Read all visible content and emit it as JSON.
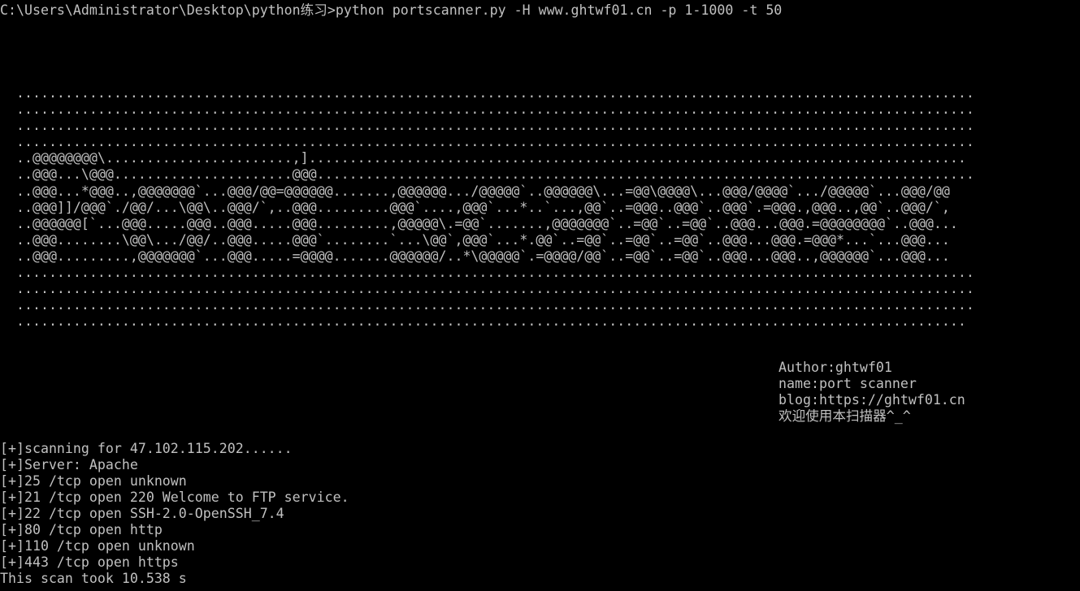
{
  "console": {
    "prompt": "C:\\Users\\Administrator\\Desktop\\python练习>",
    "command": "python portscanner.py -H www.ghtwf01.cn -p 1-1000 -t 50"
  },
  "banner": {
    "lines": [
      "  ......................................................................................................................",
      "  ......................................................................................................................",
      "  ......................................................................................................................",
      "  ......................................................................................................................",
      "  ..@@@@@@@@\\.......................,].................................................................................",
      "  ..@@@...\\@@@......................@@@.................................................................................",
      "  ..@@@...*@@@..,@@@@@@@`...@@@/@@=@@@@@@.......,@@@@@@.../@@@@@`..@@@@@@\\...=@@\\@@@@\\...@@@/@@@@`.../@@@@@`...@@@/@@",
      "  ..@@@]]/@@@`./@@/...\\@@\\..@@@/`,..@@@.........@@@`....,@@@`...*..`...,@@`..=@@@..@@@`..@@@`.=@@@.,@@@..,@@`..@@@/`,",
      "  ..@@@@@@[`...@@@.....@@@..@@@.....@@@.........,@@@@@\\.=@@`.......,@@@@@@@`..=@@`..=@@`..@@@...@@@.=@@@@@@@@`..@@@...",
      "  ..@@@........\\@@\\.../@@/..@@@.....@@@`........`...\\@@`,@@@`...*.@@`..=@@`..=@@`..=@@`..@@@...@@@.=@@@*...`...@@@...",
      "  ..@@@.........,@@@@@@@`...@@@.....=@@@@.......@@@@@@/..*\\@@@@@`.=@@@@/@@`..=@@`..=@@`..@@@...@@@..,@@@@@@`...@@@...",
      "  ......................................................................................................................",
      "  ......................................................................................................................",
      "  ......................................................................................................................",
      "  ....................................................................................................................."
    ]
  },
  "info": {
    "author": "Author:ghtwf01",
    "name": "name:port scanner",
    "blog": "blog:https://ghtwf01.cn",
    "welcome": "欢迎使用本扫描器^_^"
  },
  "output": {
    "lines": [
      "[+]scanning for 47.102.115.202......",
      "[+]Server: Apache",
      "[+]25 /tcp open unknown",
      "[+]21 /tcp open 220 Welcome to FTP service.",
      "[+]22 /tcp open SSH-2.0-OpenSSH_7.4",
      "[+]80 /tcp open http",
      "[+]110 /tcp open unknown",
      "[+]443 /tcp open https",
      "This scan took 10.538 s"
    ]
  },
  "colors": {
    "background": "#000000",
    "text": "#c0c0c0"
  }
}
